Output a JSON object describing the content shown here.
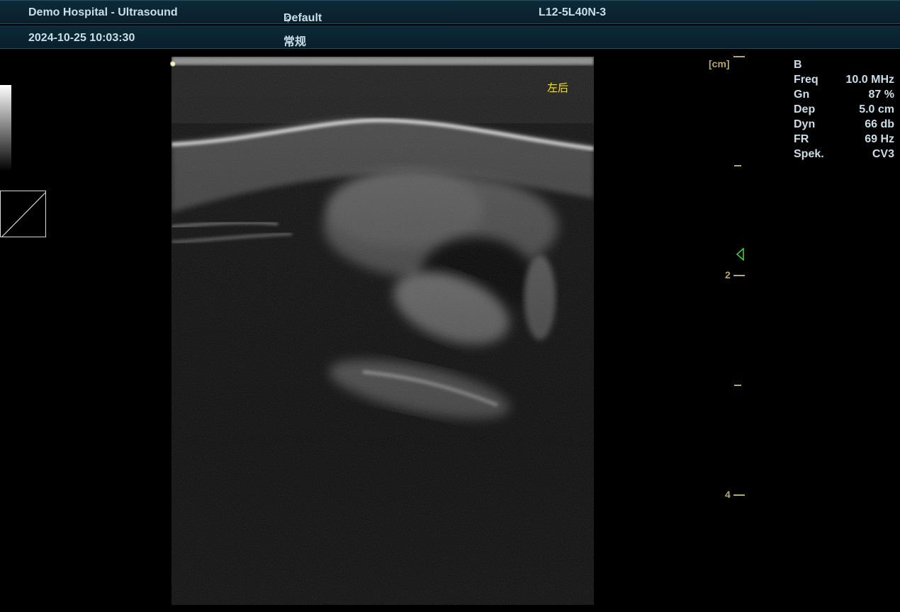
{
  "header": {
    "hospital": "Demo Hospital - Ultrasound",
    "preset": "Default",
    "gender_symbol": "♀",
    "probe": "L12-5L40N-3",
    "datetime": "2024-10-25 10:03:30",
    "exam_type": "常规"
  },
  "image": {
    "orientation_label": "左后"
  },
  "depth_scale": {
    "unit": "[cm]",
    "labels": [
      "2",
      "4"
    ]
  },
  "params": {
    "mode": "B",
    "rows": [
      {
        "label": "Freq",
        "value": "10.0 MHz"
      },
      {
        "label": "Gn",
        "value": "87 %"
      },
      {
        "label": "Dep",
        "value": "5.0 cm"
      },
      {
        "label": "Dyn",
        "value": "66 db"
      },
      {
        "label": "FR",
        "value": "69 Hz"
      },
      {
        "label": "Spek.",
        "value": "CV3"
      }
    ]
  },
  "colors": {
    "header_text": "#c8dfe8",
    "scale": "#b6a86a",
    "orientation": "#f5e600",
    "focus_marker": "#37d137"
  },
  "icons": {
    "gender": "female-symbol-icon",
    "focus": "focus-marker-icon"
  }
}
